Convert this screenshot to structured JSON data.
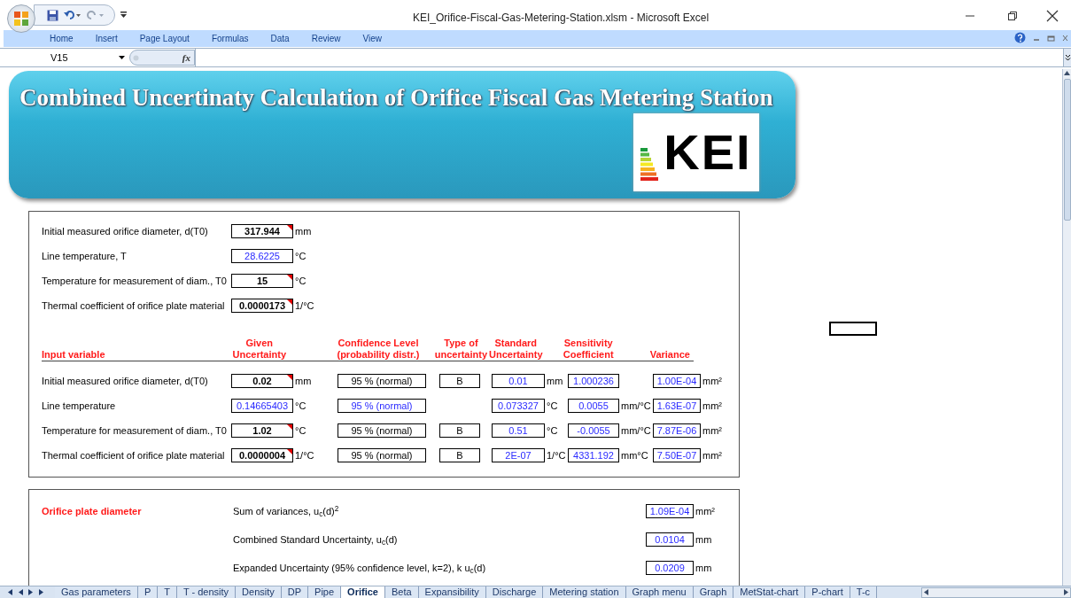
{
  "window": {
    "title": "KEI_Orifice-Fiscal-Gas-Metering-Station.xlsm - Microsoft Excel"
  },
  "ribbon_tabs": [
    "Home",
    "Insert",
    "Page Layout",
    "Formulas",
    "Data",
    "Review",
    "View"
  ],
  "formula_bar": {
    "name_box": "V15",
    "fx": "fx"
  },
  "banner": {
    "title": "Combined Uncertinaty Calculation of Orifice Fiscal  Gas Metering Station",
    "logo": "KEI"
  },
  "inputs": [
    {
      "label": "Initial measured orifice diameter, d(T0)",
      "value": "317.944",
      "unit": "mm",
      "kind": "input"
    },
    {
      "label": "Line temperature, T",
      "value": "28.6225",
      "unit": "°C",
      "kind": "calc"
    },
    {
      "label": "Temperature for measurement of diam., T0",
      "value": "15",
      "unit": "°C",
      "kind": "input"
    },
    {
      "label": "Thermal coefficient of orifice plate material",
      "value": "0.0000173",
      "unit": "1/°C",
      "kind": "input"
    }
  ],
  "table": {
    "columns": [
      [
        "Input variable"
      ],
      [
        "Given",
        "Uncertainty"
      ],
      [
        "Confidence Level",
        "(probability distr.)"
      ],
      [
        "Type of",
        "uncertainty"
      ],
      [
        "Standard",
        "Uncertainty"
      ],
      [
        "Sensitivity",
        "Coefficient"
      ],
      [
        "Variance"
      ]
    ],
    "rows": [
      {
        "label": "Initial measured orifice diameter, d(T0)",
        "given": {
          "value": "0.02",
          "unit": "mm",
          "kind": "input"
        },
        "confidence": {
          "value": "95 % (normal)",
          "kind": "input"
        },
        "type": "B",
        "standard": {
          "value": "0.01",
          "unit": "mm"
        },
        "sensitivity": {
          "value": "1.000236"
        },
        "variance": {
          "value": "1.00E-04",
          "unit": "mm²"
        }
      },
      {
        "label": "Line temperature",
        "given": {
          "value": "0.14665403",
          "unit": "°C",
          "kind": "calc"
        },
        "confidence": {
          "value": "95 % (normal)",
          "kind": "calc"
        },
        "standard": {
          "value": "0.073327",
          "unit": "°C"
        },
        "sensitivity": {
          "value": "0.0055",
          "unit": "mm/°C"
        },
        "variance": {
          "value": "1.63E-07",
          "unit": "mm²"
        }
      },
      {
        "label": "Temperature for measurement of diam., T0",
        "given": {
          "value": "1.02",
          "unit": "°C",
          "kind": "input"
        },
        "confidence": {
          "value": "95 % (normal)",
          "kind": "input"
        },
        "type": "B",
        "standard": {
          "value": "0.51",
          "unit": "°C"
        },
        "sensitivity": {
          "value": "-0.0055",
          "unit": "mm/°C"
        },
        "variance": {
          "value": "7.87E-06",
          "unit": "mm²"
        }
      },
      {
        "label": "Thermal coefficient of orifice plate material",
        "given": {
          "value": "0.0000004",
          "unit": "1/°C",
          "kind": "input"
        },
        "confidence": {
          "value": "95 % (normal)",
          "kind": "input"
        },
        "type": "B",
        "standard": {
          "value": "2E-07",
          "unit": "1/°C"
        },
        "sensitivity": {
          "value": "4331.192",
          "unit": "mm°C"
        },
        "variance": {
          "value": "7.50E-07",
          "unit": "mm²"
        }
      }
    ]
  },
  "results": {
    "title": "Orifice plate diameter",
    "items": [
      {
        "label": "Sum of variances, u$_{c}$(d)$^{2}$",
        "value": "1.09E-04",
        "unit": "mm²"
      },
      {
        "label": "Combined Standard Uncertainty, u$_{c}$(d)",
        "value": "0.0104",
        "unit": "mm"
      },
      {
        "label": "Expanded Uncertainty (95% confidence level, k=2), k u$_{c}$(d)",
        "value": "0.0209",
        "unit": "mm"
      }
    ]
  },
  "sheet_tabs": [
    {
      "label": "Gas parameters",
      "selected": false
    },
    {
      "label": "P",
      "selected": false
    },
    {
      "label": "T",
      "selected": false
    },
    {
      "label": "T - density",
      "selected": false
    },
    {
      "label": "Density",
      "selected": false
    },
    {
      "label": "DP",
      "selected": false
    },
    {
      "label": "Pipe",
      "selected": false
    },
    {
      "label": "Orifice",
      "selected": true
    },
    {
      "label": "Beta",
      "selected": false
    },
    {
      "label": "Expansibility",
      "selected": false
    },
    {
      "label": "Discharge",
      "selected": false
    },
    {
      "label": "Metering station",
      "selected": false
    },
    {
      "label": "Graph menu",
      "selected": false
    },
    {
      "label": "Graph",
      "selected": false
    },
    {
      "label": "MetStat-chart",
      "selected": false
    },
    {
      "label": "P-chart",
      "selected": false
    },
    {
      "label": "T-c",
      "selected": false
    }
  ]
}
